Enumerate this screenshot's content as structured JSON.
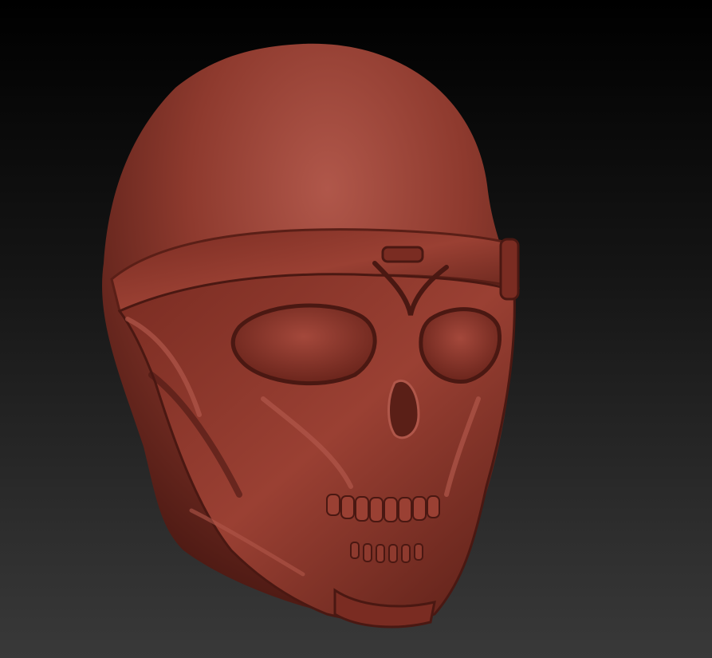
{
  "viewport": {
    "background_top": "#000000",
    "background_bottom": "#393939"
  },
  "model": {
    "description_visible": false,
    "material_color": "#8e3a2e",
    "highlight_color": "#b0574a",
    "shadow_color": "#4a1812",
    "subject_icon": "skull-mask-head-sculpt"
  }
}
